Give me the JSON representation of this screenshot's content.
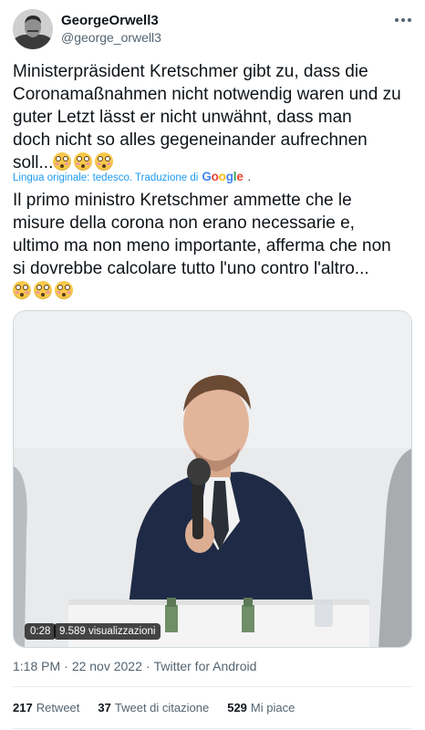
{
  "user": {
    "display_name": "GeorgeOrwell3",
    "handle": "@george_orwell3"
  },
  "icons": {
    "more": "more-horizontal-icon",
    "avatar": "avatar-portrait"
  },
  "tweet": {
    "original_lines": [
      "Ministerpräsident Kretschmer gibt zu, dass die",
      "Coronamaßnahmen nicht notwendig waren und zu",
      "guter Letzt lässt er nicht unwähnt, dass man",
      "doch nicht so alles gegeneinander aufrechnen",
      "soll..."
    ],
    "translation_note": "Lingua originale: tedesco. Traduzione di",
    "translation_provider": "Google",
    "translated_lines": [
      "Il primo ministro Kretschmer ammette che le",
      "misure della corona non erano necessarie e,",
      "ultimo ma non meno importante, afferma che non",
      "si dovrebbe calcolare tutto l'uno contro l'altro..."
    ],
    "emoji": "flushed-face"
  },
  "video": {
    "timestamp": "0:28",
    "views": "9.589 visualizzazioni"
  },
  "meta": {
    "time": "1:18 PM",
    "date": "22 nov 2022",
    "source": "Twitter for Android",
    "separator": "·"
  },
  "stats": {
    "retweets_count": "217",
    "retweets_label": "Retweet",
    "quotes_count": "37",
    "quotes_label": "Tweet di citazione",
    "likes_count": "529",
    "likes_label": "Mi piace"
  },
  "colors": {
    "link": "#1d9bf0",
    "secondary_text": "#536471",
    "primary_text": "#0f1419"
  }
}
